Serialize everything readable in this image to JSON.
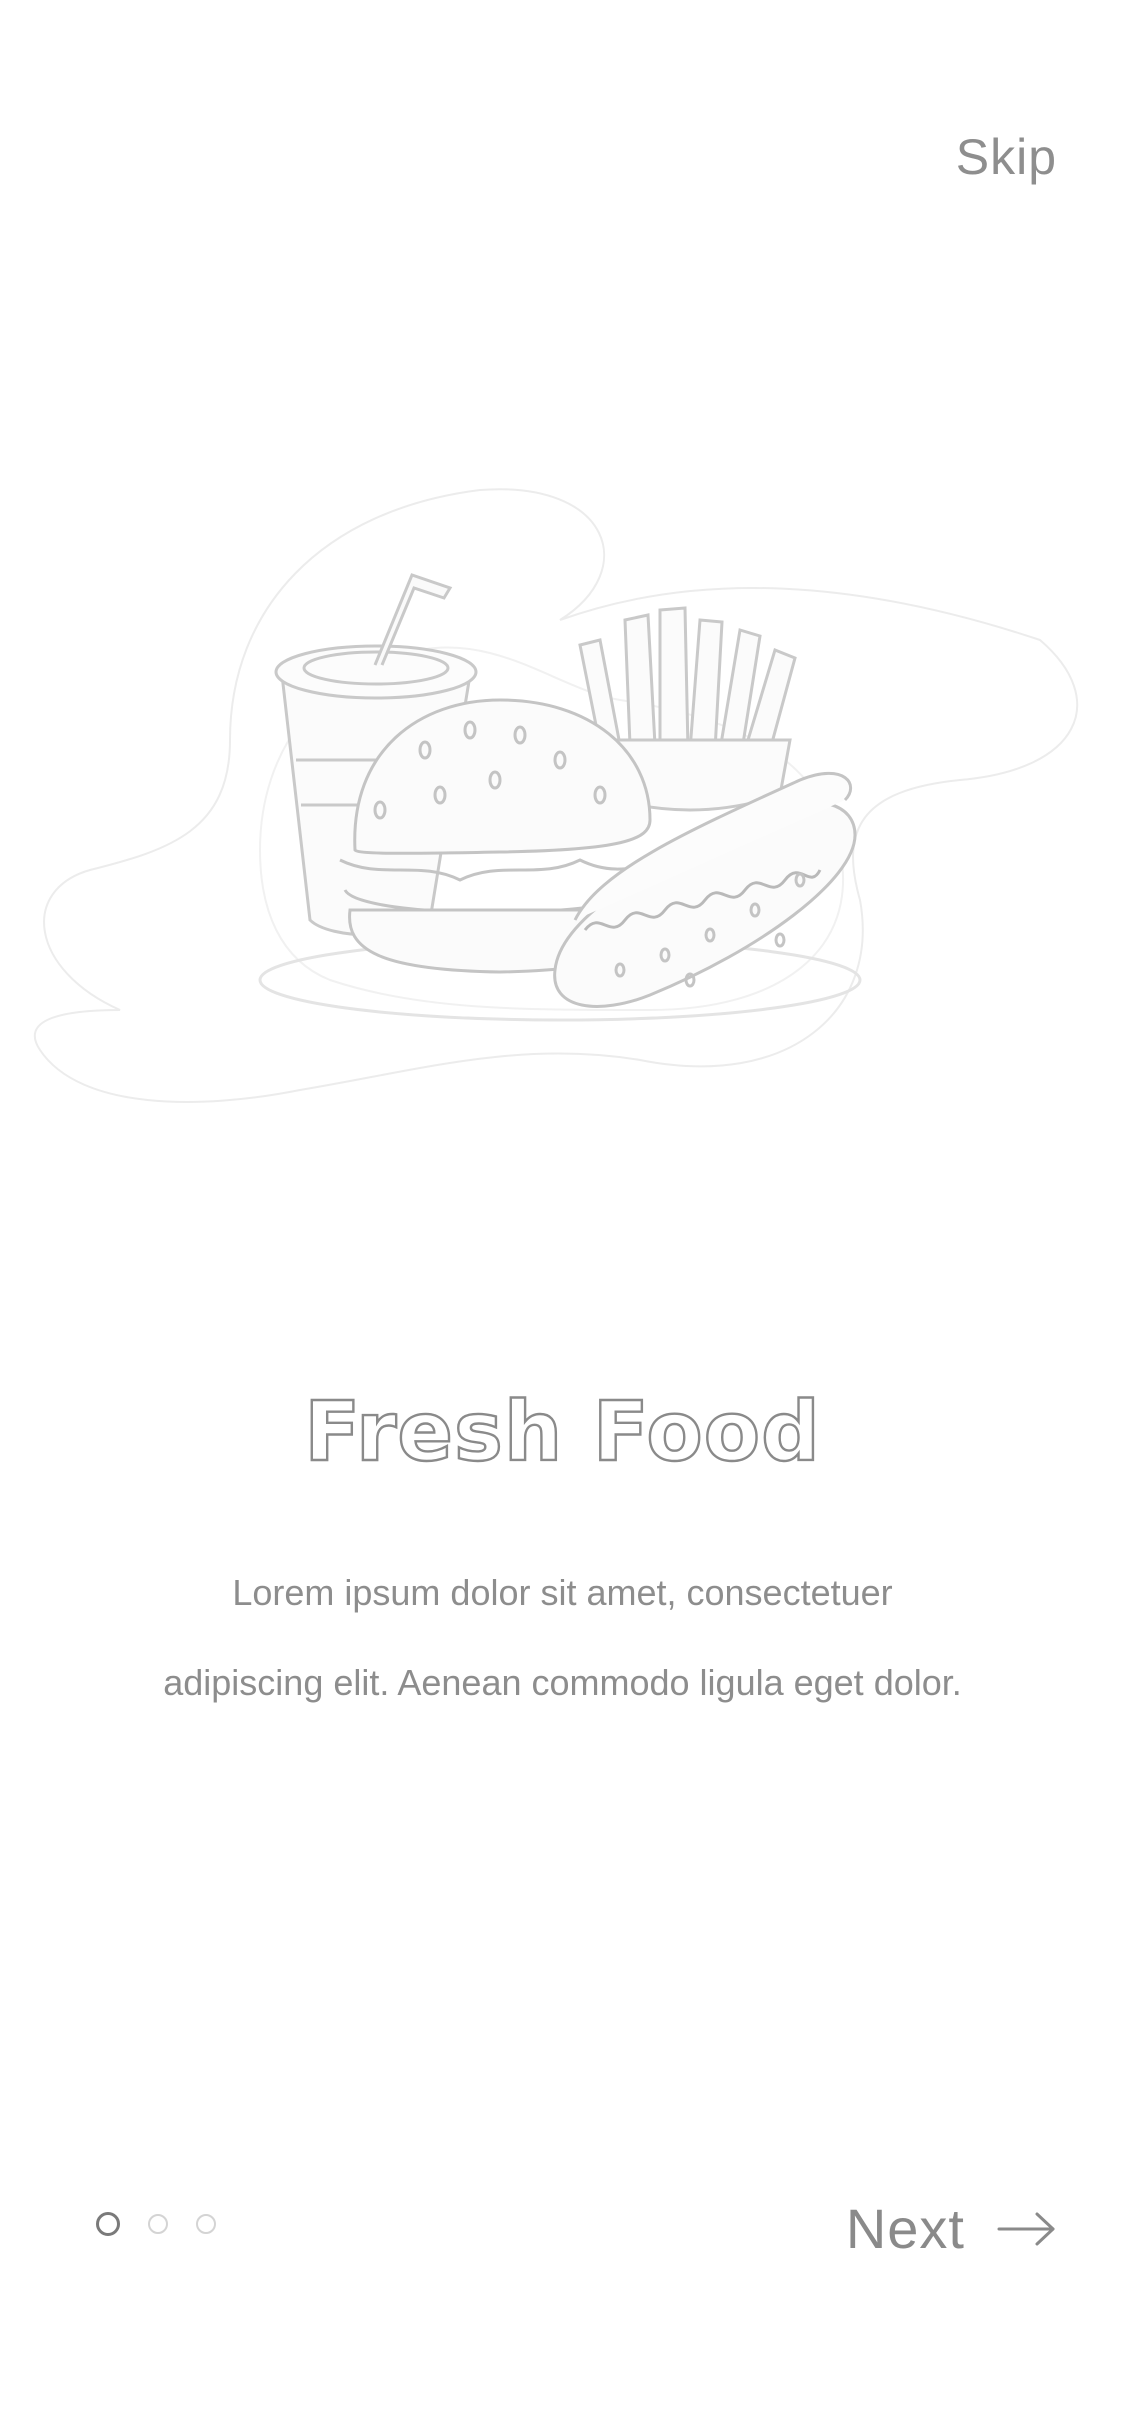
{
  "header": {
    "skip_label": "Skip"
  },
  "illustration": {
    "icon": "fast-food-illustration"
  },
  "content": {
    "title": "Fresh Food",
    "description": "Lorem ipsum dolor sit amet, consectetuer adipiscing elit. Aenean commodo ligula eget dolor."
  },
  "pager": {
    "page_count": 3,
    "active_index": 0
  },
  "footer": {
    "next_label": "Next",
    "next_icon": "arrow-right-icon"
  },
  "colors": {
    "text": "#8a8a8a",
    "dot_active": "#7a7a7a",
    "dot_inactive": "#d4d4d4",
    "background": "#ffffff"
  }
}
